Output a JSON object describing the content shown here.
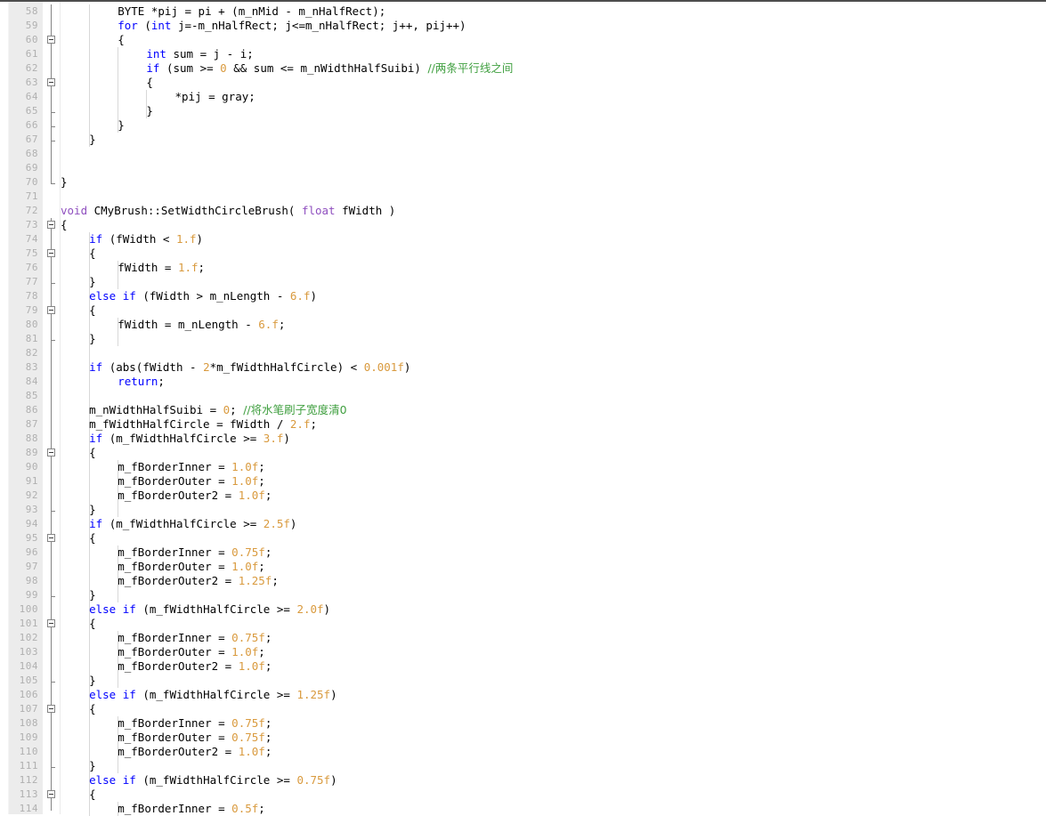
{
  "editor": {
    "name": "code-editor",
    "language": "cpp",
    "font_size_px": 12.5,
    "line_height_px": 16,
    "first_visible_line": 58,
    "last_visible_line": 114,
    "colors": {
      "background": "#ffffff",
      "gutter_background": "#ececec",
      "line_number": "#b0b0b0",
      "keyword": "#0000ff",
      "number": "#d99a3e",
      "comment": "#3f9f3f",
      "macro": "#8f4fbf",
      "text": "#000000",
      "indent_guide": "#d8d8d8",
      "outline_rail": "#848484"
    }
  },
  "lines": [
    {
      "n": 58,
      "indent": 2,
      "tokens": [
        {
          "t": "BYTE *pij = pi + (m_nMid - m_nHalfRect);"
        }
      ]
    },
    {
      "n": 59,
      "indent": 2,
      "tokens": [
        {
          "t": "for ",
          "c": "kw"
        },
        {
          "t": "("
        },
        {
          "t": "int",
          "c": "kw"
        },
        {
          "t": " j=-m_nHalfRect; j<=m_nHalfRect; j++, pij++)"
        }
      ]
    },
    {
      "n": 60,
      "indent": 2,
      "tokens": [
        {
          "t": "{"
        }
      ]
    },
    {
      "n": 61,
      "indent": 3,
      "tokens": [
        {
          "t": "int",
          "c": "kw"
        },
        {
          "t": " sum = j - i;"
        }
      ]
    },
    {
      "n": 62,
      "indent": 3,
      "tokens": [
        {
          "t": "if",
          "c": "kw"
        },
        {
          "t": " (sum >= "
        },
        {
          "t": "0",
          "c": "num"
        },
        {
          "t": " && sum <= m_nWidthHalfSuibi) "
        },
        {
          "t": "//两条平行线之间",
          "c": "cmt"
        }
      ]
    },
    {
      "n": 63,
      "indent": 3,
      "tokens": [
        {
          "t": "{"
        }
      ]
    },
    {
      "n": 64,
      "indent": 4,
      "tokens": [
        {
          "t": "*pij = gray;"
        }
      ]
    },
    {
      "n": 65,
      "indent": 3,
      "tokens": [
        {
          "t": "}"
        }
      ]
    },
    {
      "n": 66,
      "indent": 2,
      "tokens": [
        {
          "t": "}"
        }
      ]
    },
    {
      "n": 67,
      "indent": 1,
      "tokens": [
        {
          "t": "}"
        }
      ]
    },
    {
      "n": 68,
      "indent": 0,
      "tokens": []
    },
    {
      "n": 69,
      "indent": 0,
      "tokens": []
    },
    {
      "n": 70,
      "indent": 0,
      "tokens": [
        {
          "t": "}"
        }
      ]
    },
    {
      "n": 71,
      "indent": 0,
      "tokens": []
    },
    {
      "n": 72,
      "indent": 0,
      "tokens": [
        {
          "t": "void",
          "c": "mac"
        },
        {
          "t": " CMyBrush::SetWidthCircleBrush( "
        },
        {
          "t": "float",
          "c": "mac"
        },
        {
          "t": " fWidth )"
        }
      ]
    },
    {
      "n": 73,
      "indent": 0,
      "tokens": [
        {
          "t": "{"
        }
      ]
    },
    {
      "n": 74,
      "indent": 1,
      "tokens": [
        {
          "t": "if",
          "c": "kw"
        },
        {
          "t": " (fWidth < "
        },
        {
          "t": "1.f",
          "c": "num"
        },
        {
          "t": ")"
        }
      ]
    },
    {
      "n": 75,
      "indent": 1,
      "tokens": [
        {
          "t": "{"
        }
      ]
    },
    {
      "n": 76,
      "indent": 2,
      "tokens": [
        {
          "t": "fWidth = "
        },
        {
          "t": "1.f",
          "c": "num"
        },
        {
          "t": ";"
        }
      ]
    },
    {
      "n": 77,
      "indent": 1,
      "tokens": [
        {
          "t": "}"
        }
      ]
    },
    {
      "n": 78,
      "indent": 1,
      "tokens": [
        {
          "t": "else",
          "c": "kw"
        },
        {
          "t": " "
        },
        {
          "t": "if",
          "c": "kw"
        },
        {
          "t": " (fWidth > m_nLength - "
        },
        {
          "t": "6.f",
          "c": "num"
        },
        {
          "t": ")"
        }
      ]
    },
    {
      "n": 79,
      "indent": 1,
      "tokens": [
        {
          "t": "{"
        }
      ]
    },
    {
      "n": 80,
      "indent": 2,
      "tokens": [
        {
          "t": "fWidth = m_nLength - "
        },
        {
          "t": "6.f",
          "c": "num"
        },
        {
          "t": ";"
        }
      ]
    },
    {
      "n": 81,
      "indent": 1,
      "tokens": [
        {
          "t": "}"
        }
      ]
    },
    {
      "n": 82,
      "indent": 0,
      "tokens": []
    },
    {
      "n": 83,
      "indent": 1,
      "tokens": [
        {
          "t": "if",
          "c": "kw"
        },
        {
          "t": " (abs(fWidth - "
        },
        {
          "t": "2",
          "c": "num"
        },
        {
          "t": "*m_fWidthHalfCircle) < "
        },
        {
          "t": "0.001f",
          "c": "num"
        },
        {
          "t": ")"
        }
      ]
    },
    {
      "n": 84,
      "indent": 2,
      "tokens": [
        {
          "t": "return",
          "c": "kw"
        },
        {
          "t": ";"
        }
      ]
    },
    {
      "n": 85,
      "indent": 0,
      "tokens": []
    },
    {
      "n": 86,
      "indent": 1,
      "tokens": [
        {
          "t": "m_nWidthHalfSuibi = "
        },
        {
          "t": "0",
          "c": "num"
        },
        {
          "t": "; "
        },
        {
          "t": "//将水笔刷子宽度清0",
          "c": "cmt"
        }
      ]
    },
    {
      "n": 87,
      "indent": 1,
      "tokens": [
        {
          "t": "m_fWidthHalfCircle = fWidth / "
        },
        {
          "t": "2.f",
          "c": "num"
        },
        {
          "t": ";"
        }
      ]
    },
    {
      "n": 88,
      "indent": 1,
      "tokens": [
        {
          "t": "if",
          "c": "kw"
        },
        {
          "t": " (m_fWidthHalfCircle >= "
        },
        {
          "t": "3.f",
          "c": "num"
        },
        {
          "t": ")"
        }
      ]
    },
    {
      "n": 89,
      "indent": 1,
      "tokens": [
        {
          "t": "{"
        }
      ]
    },
    {
      "n": 90,
      "indent": 2,
      "tokens": [
        {
          "t": "m_fBorderInner = "
        },
        {
          "t": "1.0f",
          "c": "num"
        },
        {
          "t": ";"
        }
      ]
    },
    {
      "n": 91,
      "indent": 2,
      "tokens": [
        {
          "t": "m_fBorderOuter = "
        },
        {
          "t": "1.0f",
          "c": "num"
        },
        {
          "t": ";"
        }
      ]
    },
    {
      "n": 92,
      "indent": 2,
      "tokens": [
        {
          "t": "m_fBorderOuter2 = "
        },
        {
          "t": "1.0f",
          "c": "num"
        },
        {
          "t": ";"
        }
      ]
    },
    {
      "n": 93,
      "indent": 1,
      "tokens": [
        {
          "t": "}"
        }
      ]
    },
    {
      "n": 94,
      "indent": 1,
      "tokens": [
        {
          "t": "if",
          "c": "kw"
        },
        {
          "t": " (m_fWidthHalfCircle >= "
        },
        {
          "t": "2.5f",
          "c": "num"
        },
        {
          "t": ")"
        }
      ]
    },
    {
      "n": 95,
      "indent": 1,
      "tokens": [
        {
          "t": "{"
        }
      ]
    },
    {
      "n": 96,
      "indent": 2,
      "tokens": [
        {
          "t": "m_fBorderInner = "
        },
        {
          "t": "0.75f",
          "c": "num"
        },
        {
          "t": ";"
        }
      ]
    },
    {
      "n": 97,
      "indent": 2,
      "tokens": [
        {
          "t": "m_fBorderOuter = "
        },
        {
          "t": "1.0f",
          "c": "num"
        },
        {
          "t": ";"
        }
      ]
    },
    {
      "n": 98,
      "indent": 2,
      "tokens": [
        {
          "t": "m_fBorderOuter2 = "
        },
        {
          "t": "1.25f",
          "c": "num"
        },
        {
          "t": ";"
        }
      ]
    },
    {
      "n": 99,
      "indent": 1,
      "tokens": [
        {
          "t": "}"
        }
      ]
    },
    {
      "n": 100,
      "indent": 1,
      "tokens": [
        {
          "t": "else",
          "c": "kw"
        },
        {
          "t": " "
        },
        {
          "t": "if",
          "c": "kw"
        },
        {
          "t": " (m_fWidthHalfCircle >= "
        },
        {
          "t": "2.0f",
          "c": "num"
        },
        {
          "t": ")"
        }
      ]
    },
    {
      "n": 101,
      "indent": 1,
      "tokens": [
        {
          "t": "{"
        }
      ]
    },
    {
      "n": 102,
      "indent": 2,
      "tokens": [
        {
          "t": "m_fBorderInner = "
        },
        {
          "t": "0.75f",
          "c": "num"
        },
        {
          "t": ";"
        }
      ]
    },
    {
      "n": 103,
      "indent": 2,
      "tokens": [
        {
          "t": "m_fBorderOuter = "
        },
        {
          "t": "1.0f",
          "c": "num"
        },
        {
          "t": ";"
        }
      ]
    },
    {
      "n": 104,
      "indent": 2,
      "tokens": [
        {
          "t": "m_fBorderOuter2 = "
        },
        {
          "t": "1.0f",
          "c": "num"
        },
        {
          "t": ";"
        }
      ]
    },
    {
      "n": 105,
      "indent": 1,
      "tokens": [
        {
          "t": "}"
        }
      ]
    },
    {
      "n": 106,
      "indent": 1,
      "tokens": [
        {
          "t": "else",
          "c": "kw"
        },
        {
          "t": " "
        },
        {
          "t": "if",
          "c": "kw"
        },
        {
          "t": " (m_fWidthHalfCircle >= "
        },
        {
          "t": "1.25f",
          "c": "num"
        },
        {
          "t": ")"
        }
      ]
    },
    {
      "n": 107,
      "indent": 1,
      "tokens": [
        {
          "t": "{"
        }
      ]
    },
    {
      "n": 108,
      "indent": 2,
      "tokens": [
        {
          "t": "m_fBorderInner = "
        },
        {
          "t": "0.75f",
          "c": "num"
        },
        {
          "t": ";"
        }
      ]
    },
    {
      "n": 109,
      "indent": 2,
      "tokens": [
        {
          "t": "m_fBorderOuter = "
        },
        {
          "t": "0.75f",
          "c": "num"
        },
        {
          "t": ";"
        }
      ]
    },
    {
      "n": 110,
      "indent": 2,
      "tokens": [
        {
          "t": "m_fBorderOuter2 = "
        },
        {
          "t": "1.0f",
          "c": "num"
        },
        {
          "t": ";"
        }
      ]
    },
    {
      "n": 111,
      "indent": 1,
      "tokens": [
        {
          "t": "}"
        }
      ]
    },
    {
      "n": 112,
      "indent": 1,
      "tokens": [
        {
          "t": "else",
          "c": "kw"
        },
        {
          "t": " "
        },
        {
          "t": "if",
          "c": "kw"
        },
        {
          "t": " (m_fWidthHalfCircle >= "
        },
        {
          "t": "0.75f",
          "c": "num"
        },
        {
          "t": ")"
        }
      ]
    },
    {
      "n": 113,
      "indent": 1,
      "tokens": [
        {
          "t": "{"
        }
      ]
    },
    {
      "n": 114,
      "indent": 2,
      "tokens": [
        {
          "t": "m_fBorderInner = "
        },
        {
          "t": "0.5f",
          "c": "num"
        },
        {
          "t": ";"
        }
      ]
    }
  ],
  "outlining": {
    "fold_boxes": [
      {
        "line": 60,
        "state": "expanded"
      },
      {
        "line": 63,
        "state": "expanded"
      },
      {
        "line": 73,
        "state": "expanded"
      },
      {
        "line": 75,
        "state": "expanded"
      },
      {
        "line": 79,
        "state": "expanded"
      },
      {
        "line": 89,
        "state": "expanded"
      },
      {
        "line": 95,
        "state": "expanded"
      },
      {
        "line": 101,
        "state": "expanded"
      },
      {
        "line": 107,
        "state": "expanded"
      },
      {
        "line": 113,
        "state": "expanded"
      }
    ],
    "rails": [
      {
        "from_line": 58,
        "to_line": 70,
        "x": 57
      },
      {
        "from_line": 73,
        "to_line": 114,
        "x": 57
      }
    ],
    "end_ticks": [
      65,
      66,
      67,
      70,
      77,
      81,
      93,
      99,
      105,
      111
    ]
  },
  "indent_guides": [
    {
      "col": 1,
      "from_line": 58,
      "to_line": 67
    },
    {
      "col": 2,
      "from_line": 61,
      "to_line": 66
    },
    {
      "col": 3,
      "from_line": 64,
      "to_line": 65
    },
    {
      "col": 1,
      "from_line": 74,
      "to_line": 114
    },
    {
      "col": 2,
      "from_line": 76,
      "to_line": 77
    },
    {
      "col": 2,
      "from_line": 80,
      "to_line": 81
    },
    {
      "col": 2,
      "from_line": 90,
      "to_line": 93
    },
    {
      "col": 2,
      "from_line": 96,
      "to_line": 99
    },
    {
      "col": 2,
      "from_line": 102,
      "to_line": 105
    },
    {
      "col": 2,
      "from_line": 108,
      "to_line": 111
    },
    {
      "col": 2,
      "from_line": 114,
      "to_line": 114
    }
  ]
}
